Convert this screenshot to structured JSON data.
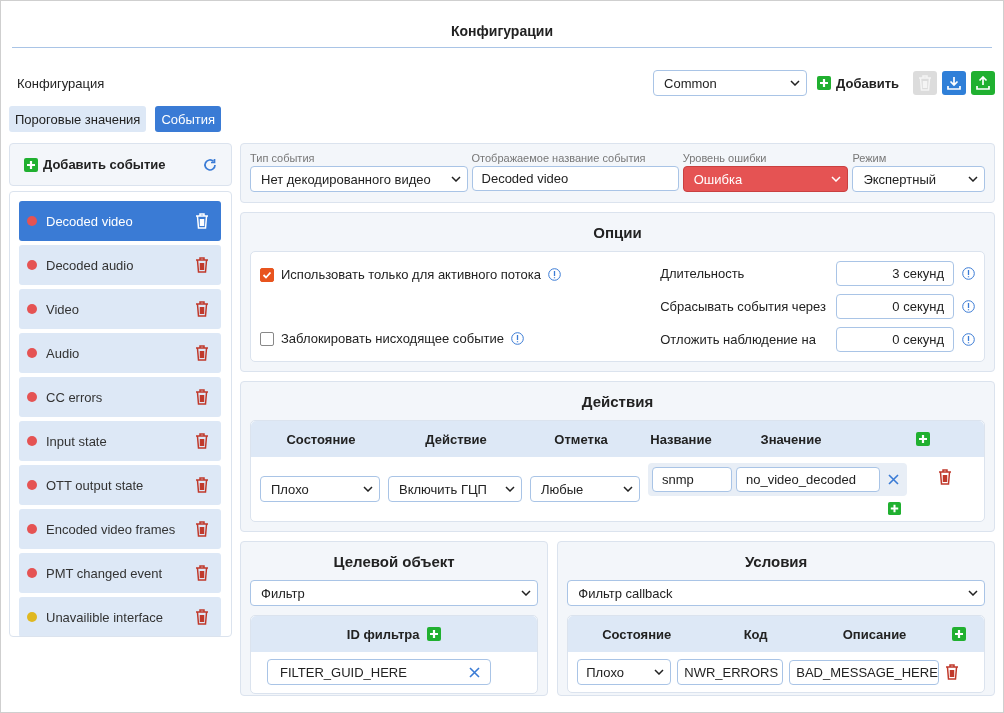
{
  "header": {
    "title": "Конфигурации"
  },
  "config": {
    "label": "Конфигурация",
    "value": "Common",
    "add_label": "Добавить"
  },
  "toolbar": [
    {
      "kind": "delete",
      "disabled": true
    },
    {
      "kind": "download",
      "disabled": false
    },
    {
      "kind": "upload",
      "disabled": false
    }
  ],
  "tabs": [
    {
      "label": "Пороговые значения",
      "selected": false
    },
    {
      "label": "События",
      "selected": true
    }
  ],
  "sidebar": {
    "add_label": "Добавить событие",
    "events": [
      {
        "name": "Decoded video",
        "color": "#e55353",
        "selected": true
      },
      {
        "name": "Decoded audio",
        "color": "#e55353",
        "selected": false
      },
      {
        "name": "Video",
        "color": "#e55353",
        "selected": false
      },
      {
        "name": "Audio",
        "color": "#e55353",
        "selected": false
      },
      {
        "name": "CC errors",
        "color": "#e55353",
        "selected": false
      },
      {
        "name": "Input state",
        "color": "#e55353",
        "selected": false
      },
      {
        "name": "OTT output state",
        "color": "#e55353",
        "selected": false
      },
      {
        "name": "Encoded video frames",
        "color": "#e55353",
        "selected": false
      },
      {
        "name": "PMT changed event",
        "color": "#e55353",
        "selected": false
      },
      {
        "name": "Unavailible interface",
        "color": "#e0b820",
        "selected": false
      }
    ]
  },
  "event_form": {
    "fields": [
      {
        "label": "Тип события",
        "value": "Нет декодированного видео",
        "kind": "select"
      },
      {
        "label": "Отображаемое название события",
        "value": "Decoded video",
        "kind": "text"
      },
      {
        "label": "Уровень ошибки",
        "value": "Ошибка",
        "kind": "alert-select"
      },
      {
        "label": "Режим",
        "value": "Экспертный",
        "kind": "select"
      }
    ]
  },
  "options": {
    "title": "Опции",
    "checks": [
      {
        "label": "Использовать только для активного потока",
        "checked": true
      },
      {
        "label": "Заблокировать нисходящее событие",
        "checked": false
      }
    ],
    "durations": [
      {
        "label": "Длительность",
        "value": "3 секунд"
      },
      {
        "label": "Сбрасывать события через",
        "value": "0 секунд"
      },
      {
        "label": "Отложить наблюдение на",
        "value": "0 секунд"
      }
    ]
  },
  "actions": {
    "title": "Действия",
    "columns": [
      "Состояние",
      "Действие",
      "Отметка",
      "Название",
      "Значение"
    ],
    "rows": [
      {
        "state": "Плохо",
        "action": "Включить ГЦП",
        "mark": "Любые",
        "name": "snmp",
        "value": "no_video_decoded"
      }
    ]
  },
  "target": {
    "title": "Целевой объект",
    "type": "Фильтр",
    "column": "ID фильтра",
    "ids": [
      "FILTER_GUID_HERE"
    ]
  },
  "conditions": {
    "title": "Условия",
    "type": "Фильтр callback",
    "columns": [
      "Состояние",
      "Код",
      "Описание"
    ],
    "rows": [
      {
        "state": "Плохо",
        "code": "NWR_ERRORS",
        "description": "BAD_MESSAGE_HERE"
      }
    ]
  }
}
